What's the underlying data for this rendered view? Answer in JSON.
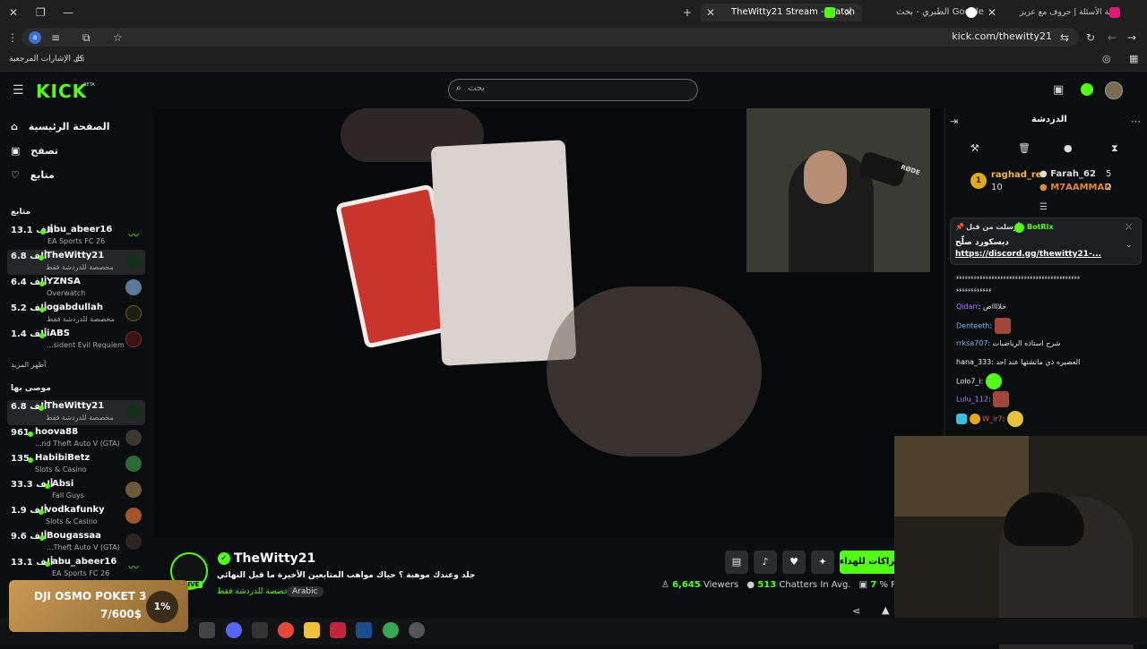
{
  "browser": {
    "tabs": [
      {
        "label": "بوابة الأسئلة | حروف مع عزيز"
      },
      {
        "label": "الطبري - بحث Google"
      },
      {
        "label": "TheWitty21 Stream - Watch"
      }
    ],
    "url": "kick.com/thewitty21",
    "bookmarks_label": "كل الإشارات المرجعية",
    "profile_letter": "a"
  },
  "header": {
    "logo": "KICK",
    "logo_beta": "BETA",
    "search_placeholder": "بحث"
  },
  "sidebar": {
    "nav": [
      {
        "label": "الصفحة الرئيسية"
      },
      {
        "label": "تصفح"
      },
      {
        "label": "متابع"
      }
    ],
    "following_title": "متابع",
    "following": [
      {
        "count": "13.1 ألف",
        "name": "abu_abeer16",
        "category": "EA Sports FC 26"
      },
      {
        "count": "6.8 ألف",
        "name": "TheWitty21",
        "category": "مخصصة للدردشة فقط"
      },
      {
        "count": "6.4 ألف",
        "name": "YZNSA",
        "category": "Overwatch"
      },
      {
        "count": "5.2 ألف",
        "name": "ogabdullah",
        "category": "مخصصة للدردشة فقط"
      },
      {
        "count": "1.4 ألف",
        "name": "iABS",
        "category": "...sident Evil Requiem"
      }
    ],
    "show_more": "أظهر المزيد",
    "recommended_title": "موصى بها",
    "recommended": [
      {
        "count": "6.8 ألف",
        "name": "TheWitty21",
        "category": "مخصصة للدردشة فقط"
      },
      {
        "count": "961",
        "name": "hoova88",
        "category": "...nd Theft Auto V (GTA)"
      },
      {
        "count": "135",
        "name": "HabibiBetz",
        "category": "Slots & Casino"
      },
      {
        "count": "33.3 ألف",
        "name": "Absi",
        "category": "Fall Guys"
      },
      {
        "count": "1.9 ألف",
        "name": "vodkafunky",
        "category": "Slots & Casino"
      },
      {
        "count": "9.6 ألف",
        "name": "Bougassaa",
        "category": "...Theft Auto V (GTA)"
      },
      {
        "count": "13.1 ألف",
        "name": "abu_abeer16",
        "category": "EA Sports FC 26"
      }
    ]
  },
  "stream": {
    "streamer": "TheWitty21",
    "live": "LIVE",
    "title": "جلد وعندك موهبة ؟  حياك مواهب المتابعين الأخيرة ما قبل النهائي",
    "category": "مخصصة للدردشة فقط",
    "tag": "Arabic",
    "subscribe_label": "اشتراكات للهداء",
    "viewers": "6,645",
    "viewers_label": "Viewers",
    "chatters": "513",
    "chatters_label": "Chatters In Avg.",
    "participation": "7",
    "participation_label": "% Parti",
    "cam_brand": "RØDE"
  },
  "chat": {
    "title": "الدردشة",
    "leaderboard": [
      {
        "rank": "1",
        "name": "raghad_re",
        "value": "10"
      },
      {
        "name": "Farah_62",
        "value": "5"
      },
      {
        "name": "M7AAMMAD",
        "value": "2"
      }
    ],
    "pinned": {
      "by": "أرسلت من قبل",
      "author": "BotRix",
      "title": "ديسكورد صلّح",
      "link": "https://discord.gg/thewitty21-..."
    },
    "messages": [
      {
        "user": "",
        "text": "ءءءءءءءءءءءءءءءءءءءءءءءءءءءءءءءءءءءءءءءءءء"
      },
      {
        "user": "",
        "text": "ءءءءءءءءءءءء"
      },
      {
        "user": "Qidarr",
        "text": "خلااااص"
      },
      {
        "user": "Denteeth",
        "text": ""
      },
      {
        "user": "rrksa707",
        "text": "شرح استاذه الرياضيات"
      },
      {
        "user": "hana_333",
        "text": "العصيره ذي ماتشتها عند احد"
      },
      {
        "user": "Lolo7_i",
        "text": ""
      },
      {
        "user": "Lulu_112",
        "text": ""
      },
      {
        "user": "W_lr7",
        "text": ""
      }
    ]
  },
  "ad": {
    "title": "DJI OSMO POKET 3",
    "price": "7/600$",
    "percent": "1%"
  },
  "colors": {
    "accent": "#53fc18",
    "background": "#0b0e0f"
  }
}
